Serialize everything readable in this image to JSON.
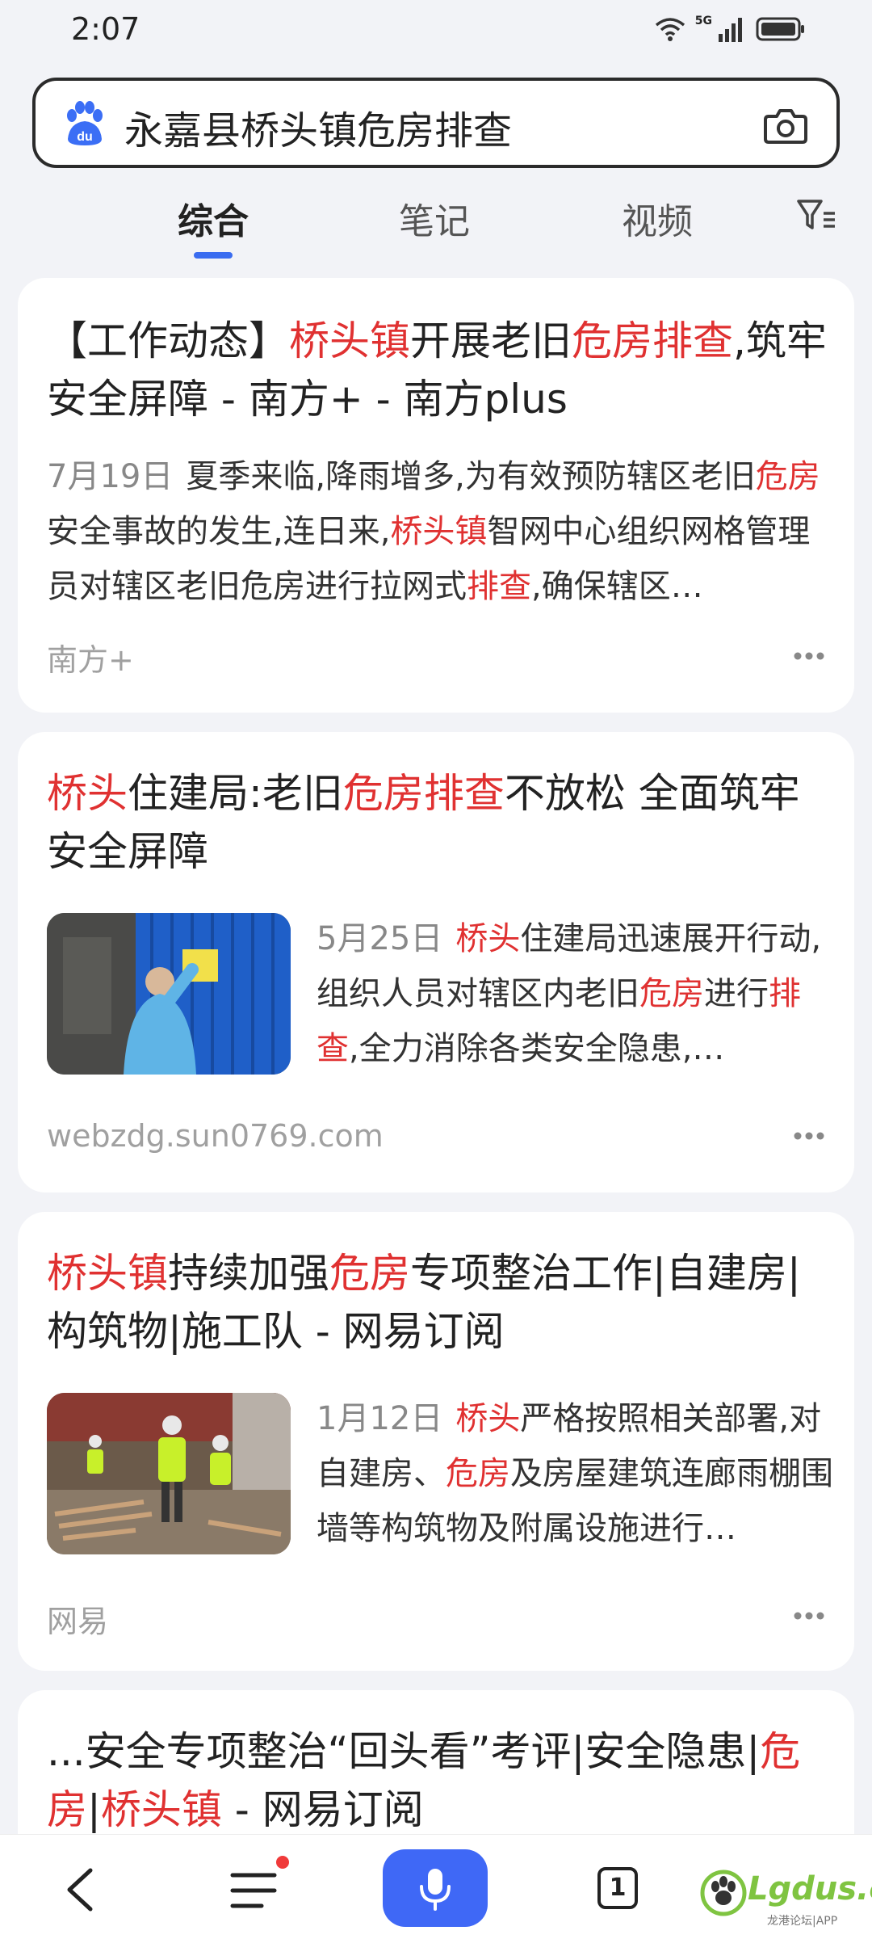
{
  "status_bar": {
    "time": "2:07",
    "network": "5G"
  },
  "search": {
    "query": "永嘉县桥头镇危房排查"
  },
  "tabs": [
    {
      "label": "综合",
      "active": true
    },
    {
      "label": "笔记",
      "active": false
    },
    {
      "label": "视频",
      "active": false
    }
  ],
  "results": [
    {
      "title_parts": [
        "【工作动态】",
        "桥头镇",
        "开展老旧",
        "危房排查",
        ",筑牢安全屏障 - 南方+ - 南方plus"
      ],
      "date": "7月19日",
      "snippet_parts": [
        "夏季来临,降雨增多,为有效预防辖区老旧",
        "危房",
        "安全事故的发生,连日来,",
        "桥头镇",
        "智网中心组织网格管理员对辖区老旧危房进行拉网式",
        "排查",
        ",确保辖区…"
      ],
      "source": "南方+"
    },
    {
      "title_parts": [
        "桥头",
        "住建局:老旧",
        "危房排查",
        "不放松 全面筑牢安全屏障"
      ],
      "date": "5月25日",
      "snippet_parts": [
        "桥头",
        "住建局迅速展开行动,组织人员对辖区内老旧",
        "危房",
        "进行",
        "排查",
        ",全力消除各类安全隐患,…"
      ],
      "source": "webzdg.sun0769.com"
    },
    {
      "title_parts": [
        "桥头镇",
        "持续加强",
        "危房",
        "专项整治工作|自建房|构筑物|施工队 - 网易订阅"
      ],
      "date": "1月12日",
      "snippet_parts": [
        "桥头",
        "严格按照相关部署,对自建房、",
        "危房",
        "及房屋建筑连廊雨棚围墙等构筑物及附属设施进行…"
      ],
      "source": "网易"
    },
    {
      "title_parts": [
        "...安全专项整治“回头看”考评|安全隐患|",
        "危房",
        "|",
        "桥头镇",
        " - 网易订阅"
      ]
    }
  ],
  "bottom_nav": {
    "tab_count": "1",
    "watermark_main": "Lgdus.cn",
    "watermark_sub": "龙港论坛|APP"
  },
  "colors": {
    "highlight": "#e03131",
    "accent": "#3a6cf0",
    "mic": "#3f68f6"
  }
}
